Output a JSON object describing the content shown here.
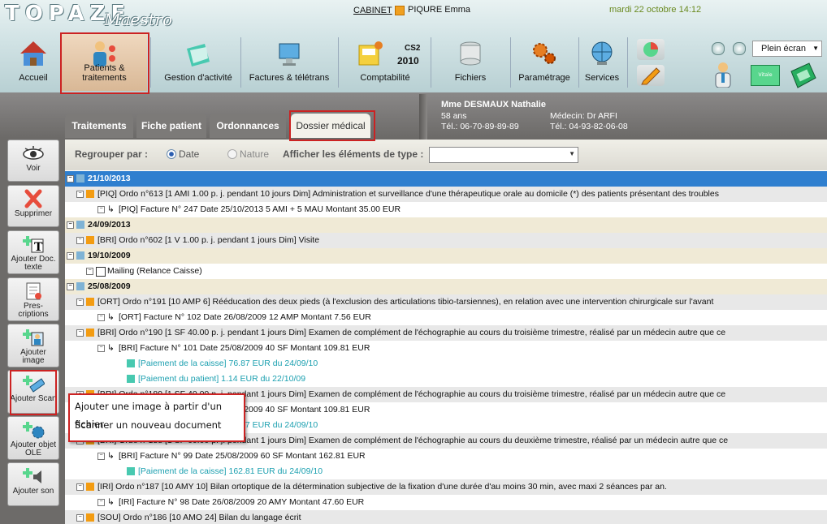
{
  "app": {
    "logo": "TOPAZE",
    "logo_sub": "Maestro"
  },
  "header": {
    "cabinet_link": "CABINET",
    "user": "PIQURE Emma",
    "datetime": "mardi 22 octobre 14:12",
    "fullscreen": "Plein écran"
  },
  "toolbar": [
    {
      "label": "Accueil",
      "icon": "house-icon"
    },
    {
      "label": "Patients & traitements",
      "icon": "patients-icon"
    },
    {
      "label": "Gestion d'activité",
      "icon": "folder-icon"
    },
    {
      "label": "Factures & télétrans",
      "icon": "monitor-icon"
    },
    {
      "label": "Comptabilité",
      "icon": "accounting-icon",
      "badge1": "CS2",
      "badge2": "2010"
    },
    {
      "label": "Fichiers",
      "icon": "database-icon"
    },
    {
      "label": "Paramétrage",
      "icon": "gears-icon"
    },
    {
      "label": "Services",
      "icon": "globe-icon"
    }
  ],
  "tabs": [
    {
      "label": "Traitements"
    },
    {
      "label": "Fiche patient"
    },
    {
      "label": "Ordonnances"
    },
    {
      "label": "Dossier médical"
    }
  ],
  "patient": {
    "name": "Mme DESMAUX Nathalie",
    "age": "58 ans",
    "phone": "Tél.: 06-70-89-89-89",
    "doctor": "Médecin: Dr ARFI",
    "doctor_phone": "Tél.: 04-93-82-06-08"
  },
  "filters": {
    "group_label": "Regrouper par :",
    "opt_date": "Date",
    "opt_nature": "Nature",
    "type_label": "Afficher les éléments de type :",
    "type_value": ""
  },
  "left_buttons": [
    {
      "label": "Voir",
      "icon": "eye-icon"
    },
    {
      "label": "Supprimer",
      "icon": "delete-x-icon"
    },
    {
      "label": "Ajouter Doc. texte",
      "icon": "add-text-icon"
    },
    {
      "label": "Pres-criptions",
      "icon": "prescription-icon"
    },
    {
      "label": "Ajouter image",
      "icon": "add-image-icon"
    },
    {
      "label": "Ajouter Scan",
      "icon": "add-scan-icon"
    },
    {
      "label": "Ajouter objet OLE",
      "icon": "add-ole-icon"
    },
    {
      "label": "Ajouter son",
      "icon": "add-sound-icon"
    }
  ],
  "rows": [
    {
      "kind": "date",
      "text": "21/10/2013",
      "selected": true
    },
    {
      "kind": "ordo",
      "text": "[PIQ] Ordo n°613 [1 AMI 1.00 p. j. pendant 10 jours Dim] Administration et surveillance d'une thérapeutique orale au domicile (*) des patients présentant des troubles"
    },
    {
      "kind": "facture",
      "text": "[PIQ] Facture N° 247 Date 25/10/2013  5 AMI + 5 MAU Montant 35.00 EUR"
    },
    {
      "kind": "date",
      "text": "24/09/2013"
    },
    {
      "kind": "ordo",
      "text": "[BRI] Ordo n°602 [1 V 1.00 p. j. pendant 1 jours Dim] Visite"
    },
    {
      "kind": "date",
      "text": "19/10/2009"
    },
    {
      "kind": "mailing",
      "text": "Mailing (Relance Caisse)"
    },
    {
      "kind": "date",
      "text": "25/08/2009"
    },
    {
      "kind": "ordo",
      "text": "[ORT] Ordo n°191 [10 AMP 6] Rééducation des deux pieds (à l'exclusion des articulations tibio-tarsiennes), en relation avec une intervention chirurgicale sur l'avant"
    },
    {
      "kind": "facture",
      "text": "[ORT] Facture N° 102 Date 26/08/2009  12 AMP Montant 7.56 EUR"
    },
    {
      "kind": "ordo",
      "text": "[BRI] Ordo n°190 [1 SF 40.00 p. j. pendant 1 jours Dim] Examen de complément de l'échographie au cours du troisième trimestre, réalisé par un médecin autre que ce"
    },
    {
      "kind": "facture",
      "text": "[BRI] Facture N° 101 Date 25/08/2009  40 SF Montant 109.81 EUR"
    },
    {
      "kind": "paiement",
      "text": "[Paiement de la caisse]  76.87 EUR du 24/09/10"
    },
    {
      "kind": "paiement",
      "text": "[Paiement du patient]  1.14 EUR du 22/10/09"
    },
    {
      "kind": "ordo",
      "text": "[BRI] Ordo n°189 [1 SF 40.00 p. j. pendant 1 jours Dim] Examen de complément de l'échographie au cours du troisième trimestre, réalisé par un médecin autre que ce"
    },
    {
      "kind": "facture",
      "text": "[BRI] Facture N° 100 Date 25/08/2009  40 SF Montant 109.81 EUR"
    },
    {
      "kind": "paiement",
      "text": "[Paiement de la caisse]  76.87 EUR du 24/09/10"
    },
    {
      "kind": "ordo",
      "text": "[BRI] Ordo n°188 [1 SF 60.00 p. j. pendant 1 jours Dim] Examen de complément de l'échographie au cours du deuxième trimestre, réalisé par un médecin autre que ce"
    },
    {
      "kind": "facture",
      "text": "[BRI] Facture N° 99 Date 25/08/2009  60 SF Montant 162.81 EUR"
    },
    {
      "kind": "paiement",
      "text": "[Paiement de la caisse]  162.81 EUR du 24/09/10"
    },
    {
      "kind": "ordo",
      "text": "[IRI] Ordo n°187 [10 AMY 10] Bilan ortoptique de la détermination subjective de la fixation d'une durée d'au moins 30 min, avec maxi 2 séances par an."
    },
    {
      "kind": "facture",
      "text": "[IRI] Facture N° 98 Date 26/08/2009  20 AMY Montant 47.60 EUR"
    },
    {
      "kind": "ordo",
      "text": "[SOU] Ordo n°186 [10 AMO 24] Bilan du langage écrit"
    }
  ],
  "popup": {
    "item1": "Ajouter une image à partir d'un fichier",
    "item2": "Scanner un nouveau document"
  }
}
